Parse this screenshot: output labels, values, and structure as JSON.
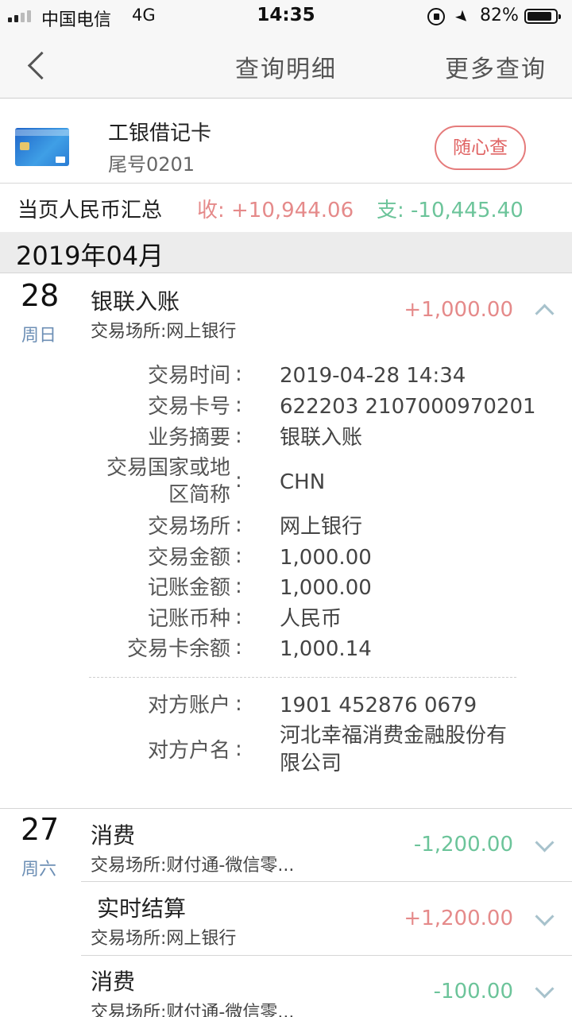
{
  "status_bar": {
    "carrier": "中国电信",
    "network": "4G",
    "time": "14:35",
    "battery": "82%"
  },
  "nav": {
    "title": "查询明细",
    "more": "更多查询"
  },
  "card": {
    "name": "工银借记卡",
    "tail": "尾号0201",
    "query_button": "随心查"
  },
  "summary": {
    "label": "当页人民币汇总",
    "income": "收: +10,944.06",
    "expense": "支: -10,445.40"
  },
  "month": "2019年04月",
  "day28": {
    "day": "28",
    "weekday": "周日",
    "title": "银联入账",
    "place": "交易场所:网上银行",
    "amount": "+1,000.00",
    "details": [
      {
        "label": "交易时间",
        "value": "2019-04-28 14:34"
      },
      {
        "label": "交易卡号",
        "value": "622203 2107000970201"
      },
      {
        "label": "业务摘要",
        "value": "银联入账"
      },
      {
        "label": "交易国家或地",
        "label2": "区简称",
        "value": "CHN"
      },
      {
        "label": "交易场所",
        "value": "网上银行"
      },
      {
        "label": "交易金额",
        "value": "1,000.00"
      },
      {
        "label": "记账金额",
        "value": "1,000.00"
      },
      {
        "label": "记账币种",
        "value": "人民币"
      },
      {
        "label": "交易卡余额",
        "value": "1,000.14"
      }
    ],
    "counterparty": [
      {
        "label": "对方账户",
        "value": "1901 452876 0679"
      },
      {
        "label": "对方户名",
        "value": "河北幸福消费金融股份有",
        "value2": "限公司"
      }
    ]
  },
  "day27": {
    "day": "27",
    "weekday": "周六",
    "items": [
      {
        "title": "消费",
        "place": "交易场所:财付通-微信零...",
        "amount": "-1,200.00"
      },
      {
        "title": "实时结算",
        "place": "交易场所:网上银行",
        "amount": "+1,200.00"
      },
      {
        "title": "消费",
        "place": "交易场所:财付通-微信零...",
        "amount": "-100.00"
      }
    ]
  },
  "colors": {
    "income": "#e58a8a",
    "expense": "#6cc49a",
    "accent_button": "#e06464",
    "weekday": "#6d8fb5"
  }
}
